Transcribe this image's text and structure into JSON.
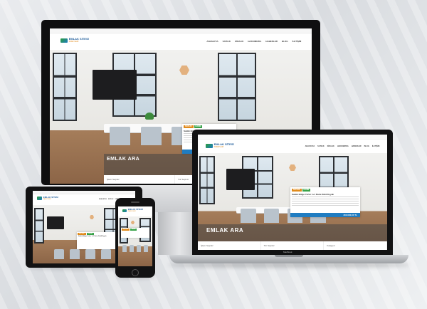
{
  "site": {
    "logo_title": "EMLAK SİTESİ",
    "logo_subtitle": "PAKETLERİ",
    "menu": [
      "ANASAYFA",
      "SATILIK",
      "KİRALIK",
      "HAKKIMIZDA",
      "HABERLER",
      "BLOG",
      "İLETİŞİM"
    ],
    "search_title": "EMLAK ARA",
    "search_fields": [
      "İşlem Seçiniz",
      "Tür Seçiniz",
      "Kategori"
    ]
  },
  "listing": {
    "tag_sale": "SATILIK",
    "tag_type": "DAİRE",
    "title": "Satılık Bölge Yerler 1+1 Daire Dahil Eşyalı",
    "price": "300.000,00 TL"
  },
  "laptop_brand": "MacBook",
  "apple_glyph": ""
}
